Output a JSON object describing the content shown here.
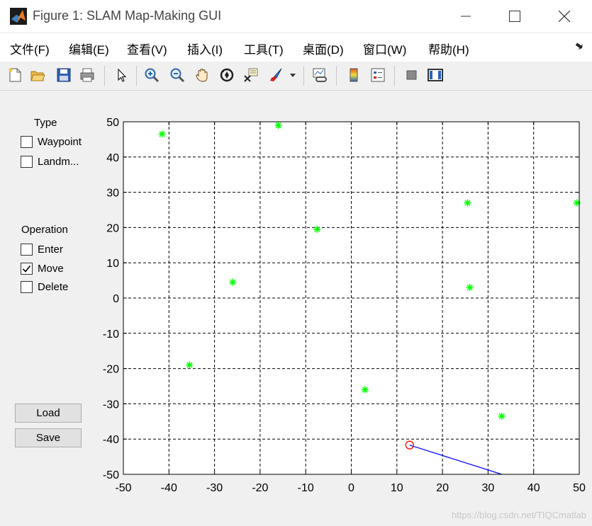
{
  "window": {
    "title": "Figure 1: SLAM Map-Making GUI"
  },
  "menu": [
    "文件(F)",
    "编辑(E)",
    "查看(V)",
    "插入(I)",
    "工具(T)",
    "桌面(D)",
    "窗口(W)",
    "帮助(H)"
  ],
  "toolbar": {
    "icons": [
      "new-figure-icon",
      "open-file-icon",
      "save-icon",
      "print-icon",
      "select-arrow-icon",
      "zoom-in-icon",
      "zoom-out-icon",
      "pan-hand-icon",
      "rotate-3d-icon",
      "data-cursor-icon",
      "brush-icon",
      "brush-dropdown-icon",
      "link-plot-icon",
      "colorbar-icon",
      "legend-icon",
      "hide-plot-tools-icon",
      "show-plot-tools-icon"
    ]
  },
  "panel": {
    "type_heading": "Type",
    "type_options": [
      {
        "label": "Waypoint",
        "checked": false
      },
      {
        "label": "Landm...",
        "checked": false
      }
    ],
    "operation_heading": "Operation",
    "operation_options": [
      {
        "label": "Enter",
        "checked": false
      },
      {
        "label": "Move",
        "checked": true
      },
      {
        "label": "Delete",
        "checked": false
      }
    ],
    "load_label": "Load",
    "save_label": "Save"
  },
  "chart_data": {
    "type": "scatter",
    "xlim": [
      -50,
      50
    ],
    "ylim": [
      -50,
      50
    ],
    "xticks": [
      -50,
      -40,
      -30,
      -20,
      -10,
      0,
      10,
      20,
      30,
      40,
      50
    ],
    "yticks": [
      -50,
      -40,
      -30,
      -20,
      -10,
      0,
      10,
      20,
      30,
      40,
      50
    ],
    "grid": true,
    "grid_style": "dashed",
    "landmarks": {
      "marker": "*",
      "color": "#00ff00",
      "points": [
        [
          -41.5,
          46.5
        ],
        [
          -16,
          49
        ],
        [
          -7.5,
          19.5
        ],
        [
          -26,
          4.5
        ],
        [
          -35.5,
          -19
        ],
        [
          3,
          -26
        ],
        [
          25.5,
          27
        ],
        [
          26,
          3
        ],
        [
          33,
          -33.5
        ],
        [
          49.5,
          27
        ]
      ]
    },
    "robot": {
      "marker": "o",
      "color": "#ff0000",
      "position": [
        12.8,
        -41.7
      ]
    },
    "heading_line": {
      "color": "#0000ff",
      "points": [
        [
          12.8,
          -41.7
        ],
        [
          33,
          -50
        ]
      ]
    }
  },
  "watermark": "https://blog.csdn.net/TIQCmatlab"
}
